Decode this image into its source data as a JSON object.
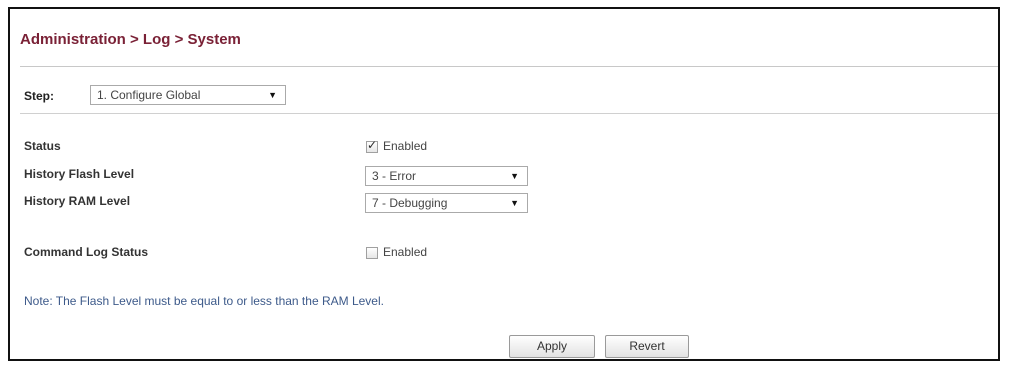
{
  "breadcrumb": "Administration > Log > System",
  "step": {
    "label": "Step:",
    "selected": "1. Configure Global"
  },
  "settings": {
    "status": {
      "label": "Status",
      "checkbox_label": "Enabled",
      "checked": true
    },
    "history_flash_level": {
      "label": "History Flash Level",
      "selected": "3 - Error"
    },
    "history_ram_level": {
      "label": "History RAM Level",
      "selected": "7 - Debugging"
    },
    "command_log_status": {
      "label": "Command Log Status",
      "checkbox_label": "Enabled",
      "checked": false
    }
  },
  "note": "Note: The Flash Level must be equal to or less than the RAM Level.",
  "buttons": {
    "apply": "Apply",
    "revert": "Revert"
  },
  "icons": {
    "dropdown": "chevron-down-icon",
    "check": "check-icon"
  },
  "colors": {
    "title": "#7a2136",
    "note": "#3d5a8a"
  }
}
